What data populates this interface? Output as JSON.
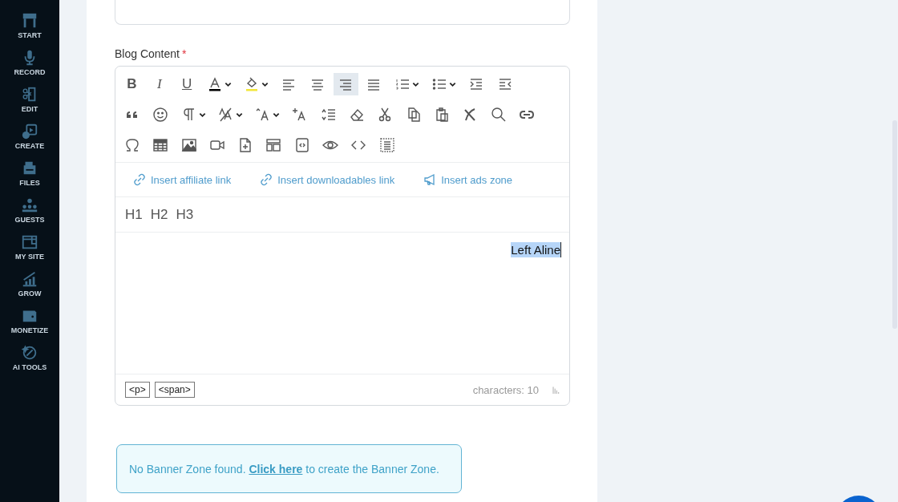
{
  "sidebar": {
    "items": [
      {
        "label": "START",
        "kind": "start"
      },
      {
        "label": "RECORD",
        "kind": "record"
      },
      {
        "label": "EDIT",
        "kind": "edit"
      },
      {
        "label": "CREATE",
        "kind": "create"
      },
      {
        "label": "FILES",
        "kind": "files"
      },
      {
        "label": "GUESTS",
        "kind": "guests"
      },
      {
        "label": "MY SITE",
        "kind": "site"
      },
      {
        "label": "GROW",
        "kind": "grow"
      },
      {
        "label": "MONETIZE",
        "kind": "monetize"
      },
      {
        "label": "AI TOOLS",
        "kind": "ai"
      }
    ]
  },
  "field": {
    "label": "Blog Content",
    "required_mark": "*"
  },
  "toolbar": {
    "rows": [
      [
        {
          "kind": "bold",
          "label": "B"
        },
        {
          "kind": "italic",
          "label": "I"
        },
        {
          "kind": "underline",
          "label": "U"
        },
        {
          "kind": "font-color",
          "dropdown": true,
          "color": "#000000"
        },
        {
          "kind": "highlight",
          "dropdown": true,
          "color": "#f2e638"
        },
        {
          "kind": "align-left"
        },
        {
          "kind": "align-center"
        },
        {
          "kind": "align-right",
          "selected": true
        },
        {
          "kind": "justify"
        },
        {
          "kind": "ordered-list",
          "dropdown": true
        },
        {
          "kind": "bullet-list",
          "dropdown": true
        },
        {
          "kind": "indent"
        },
        {
          "kind": "outdent"
        }
      ],
      [
        {
          "kind": "quote"
        },
        {
          "kind": "emoji"
        },
        {
          "kind": "paragraph",
          "dropdown": true
        },
        {
          "kind": "font-size",
          "dropdown": true
        },
        {
          "kind": "text-case",
          "dropdown": true
        },
        {
          "kind": "insert-format"
        },
        {
          "kind": "line-height"
        },
        {
          "kind": "eraser"
        },
        {
          "kind": "cut"
        },
        {
          "kind": "copy"
        },
        {
          "kind": "paste"
        },
        {
          "kind": "clear"
        },
        {
          "kind": "search"
        },
        {
          "kind": "link"
        }
      ],
      [
        {
          "kind": "omega"
        },
        {
          "kind": "table"
        },
        {
          "kind": "image"
        },
        {
          "kind": "video"
        },
        {
          "kind": "file-add"
        },
        {
          "kind": "layout"
        },
        {
          "kind": "code-block"
        },
        {
          "kind": "preview"
        },
        {
          "kind": "code"
        },
        {
          "kind": "select-all"
        }
      ]
    ]
  },
  "insert_links": [
    {
      "label": "Insert affiliate link",
      "kind": "link"
    },
    {
      "label": "Insert downloadables link",
      "kind": "link"
    },
    {
      "label": "Insert ads zone",
      "kind": "megaphone"
    }
  ],
  "headings": [
    "H1",
    "H2",
    "H3"
  ],
  "content": {
    "text": "Left Aline",
    "selected": true
  },
  "status_bar": {
    "tags": [
      "<p>",
      "<span>"
    ],
    "count": "characters: 10"
  },
  "notice": {
    "text": "No Banner Zone found.",
    "link": "Click here",
    "rest": "to create the Banner Zone."
  }
}
